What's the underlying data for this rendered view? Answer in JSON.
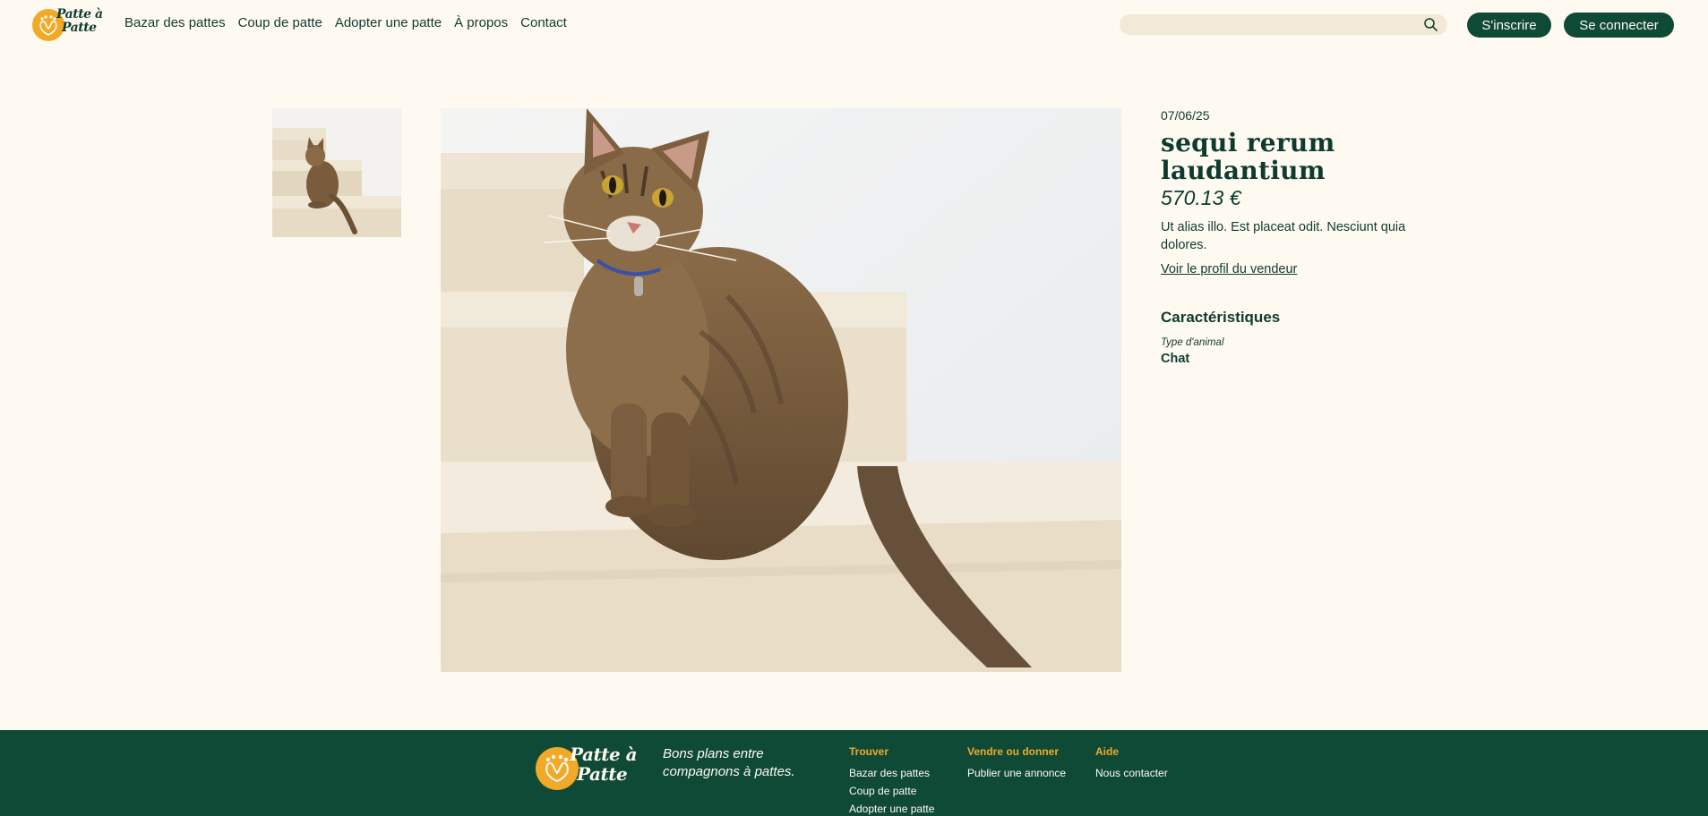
{
  "header": {
    "logo": {
      "line1": "Patte à",
      "line2": "Patte"
    },
    "nav": [
      {
        "label": "Bazar des pattes"
      },
      {
        "label": "Coup de patte"
      },
      {
        "label": "Adopter une patte"
      },
      {
        "label": "À propos"
      },
      {
        "label": "Contact"
      }
    ],
    "search": {
      "placeholder": "",
      "value": "",
      "icon": "search-icon"
    },
    "signup_label": "S'inscrire",
    "login_label": "Se connecter"
  },
  "product": {
    "date": "07/06/25",
    "title": "sequi rerum laudantium",
    "price": "570.13 €",
    "description": "Ut alias illo. Est placeat odit. Nesciunt quia dolores.",
    "seller_link": "Voir le profil du vendeur",
    "specs_title": "Caractéristiques",
    "specs": [
      {
        "label": "Type d'animal",
        "value": "Chat"
      }
    ]
  },
  "footer": {
    "logo": {
      "line1": "Patte à",
      "line2": "Patte"
    },
    "tagline": "Bons plans entre compagnons à pattes.",
    "columns": [
      {
        "title": "Trouver",
        "links": [
          "Bazar des pattes",
          "Coup de patte",
          "Adopter une patte"
        ]
      },
      {
        "title": "Vendre ou donner",
        "links": [
          "Publier une annonce"
        ]
      },
      {
        "title": "Aide",
        "links": [
          "Nous contacter"
        ]
      }
    ]
  },
  "colors": {
    "background": "#fefaf2",
    "primary": "#0f4a37",
    "accent": "#f1a928",
    "search_bg": "#f2ead7"
  }
}
